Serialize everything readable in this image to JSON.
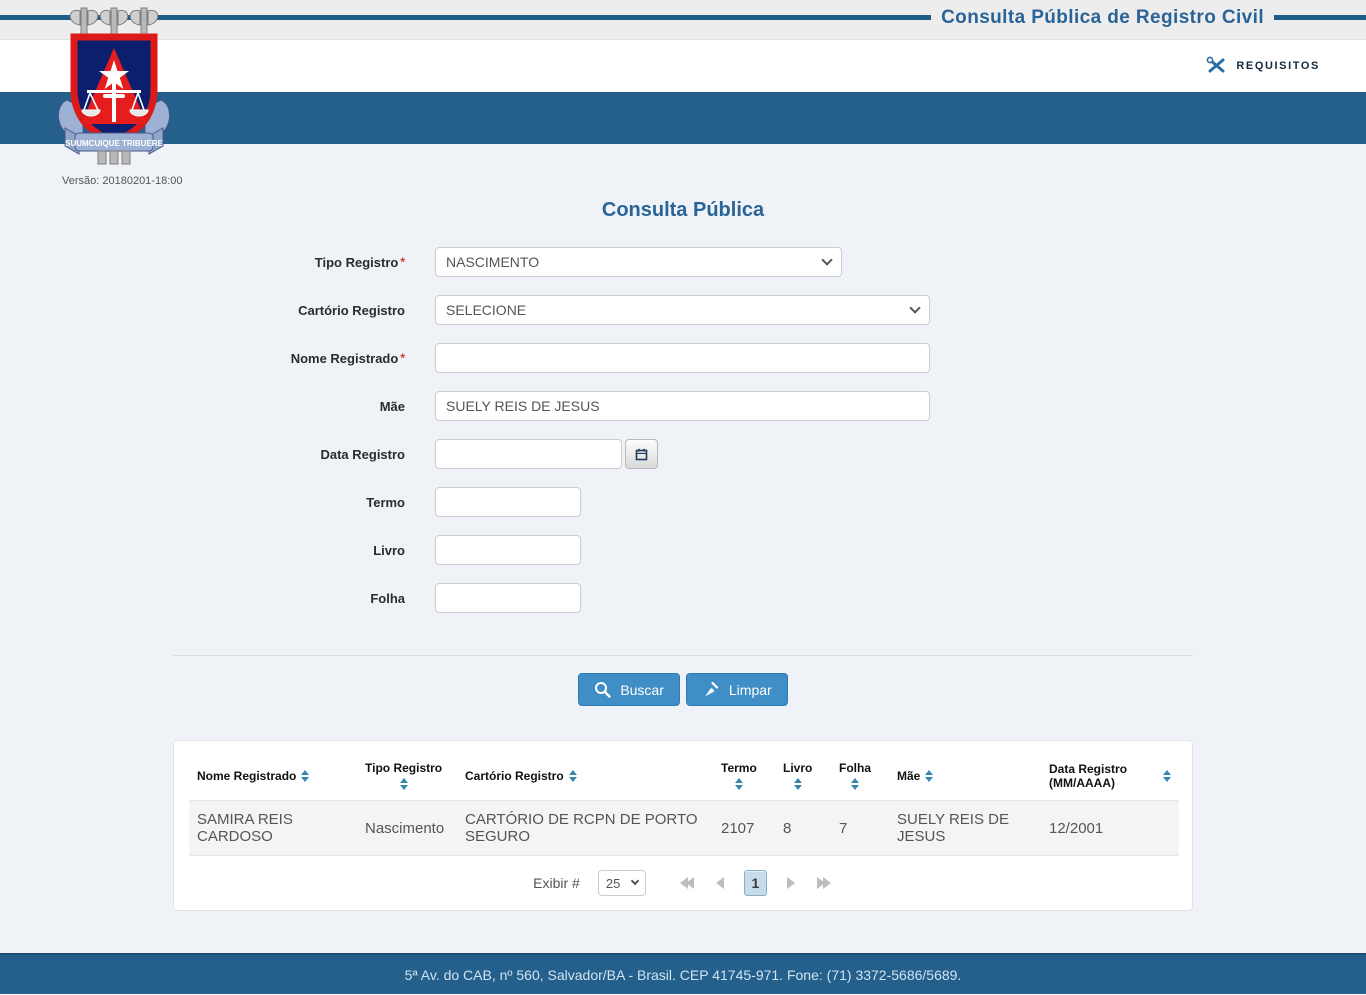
{
  "header": {
    "app_title": "Consulta Pública de Registro Civil",
    "requisitos_label": "REQUISITOS",
    "version": "Versão: 20180201-18:00",
    "logo_motto": "SUUMCUIQUE TRIBUERE"
  },
  "form": {
    "title": "Consulta Pública",
    "required_marker": "*",
    "tipo_registro": {
      "label": "Tipo Registro",
      "value": "NASCIMENTO"
    },
    "cartorio_registro": {
      "label": "Cartório Registro",
      "value": "SELECIONE"
    },
    "nome_registrado": {
      "label": "Nome Registrado",
      "value": ""
    },
    "mae": {
      "label": "Mãe",
      "value": "SUELY REIS DE JESUS"
    },
    "data_registro": {
      "label": "Data Registro",
      "value": ""
    },
    "termo": {
      "label": "Termo",
      "value": ""
    },
    "livro": {
      "label": "Livro",
      "value": ""
    },
    "folha": {
      "label": "Folha",
      "value": ""
    },
    "buscar_label": "Buscar",
    "limpar_label": "Limpar"
  },
  "table": {
    "columns": [
      "Nome Registrado",
      "Tipo Registro",
      "Cartório Registro",
      "Termo",
      "Livro",
      "Folha",
      "Mãe",
      "Data Registro (MM/AAAA)"
    ],
    "rows": [
      {
        "nome_registrado": "SAMIRA REIS CARDOSO",
        "tipo_registro": "Nascimento",
        "cartorio_registro": "CARTÓRIO DE RCPN DE PORTO SEGURO",
        "termo": "2107",
        "livro": "8",
        "folha": "7",
        "mae": "SUELY REIS DE JESUS",
        "data_registro": "12/2001"
      }
    ],
    "pagination": {
      "exibir_label": "Exibir #",
      "page_size": "25",
      "current_page": "1"
    }
  },
  "footer": {
    "address": "5ª Av. do CAB, nº 560, Salvador/BA - Brasil. CEP 41745-971. Fone: (71) 3372-5686/5689."
  },
  "colors": {
    "accent_blue": "#255f8c",
    "title_blue": "#2a6496",
    "button_blue": "#3f8ec6",
    "sort_icon_blue": "#3a87ad"
  }
}
